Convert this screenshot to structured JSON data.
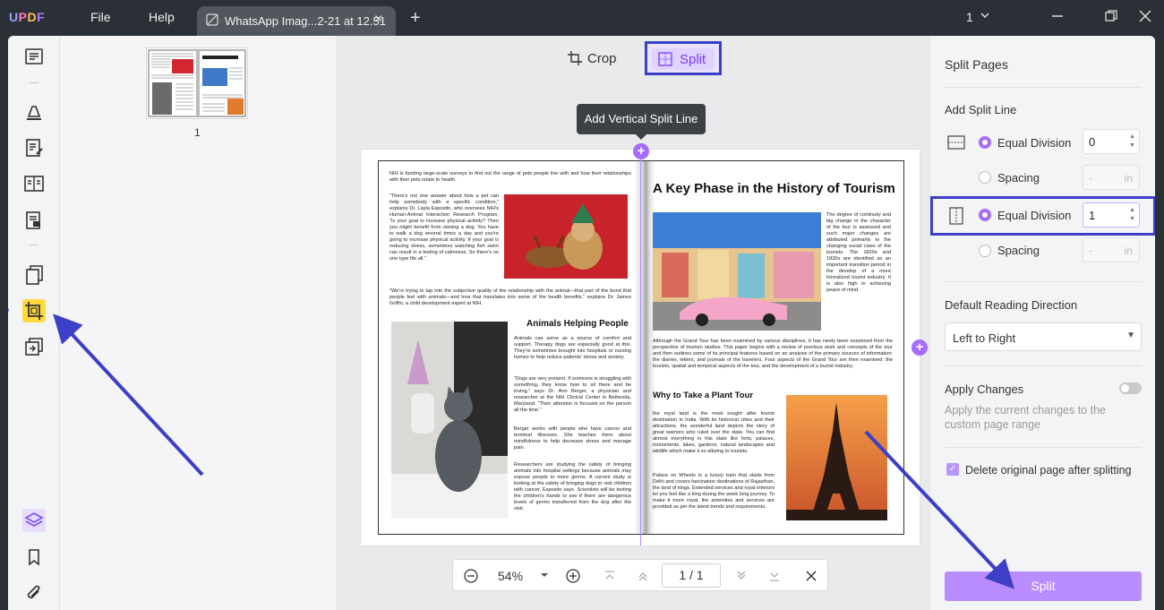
{
  "app": {
    "logo": "UPDF",
    "menu": [
      "File",
      "Help"
    ],
    "tab_title": "WhatsApp Imag...2-21 at 12.51",
    "page_indicator": "1"
  },
  "thumbnails": {
    "page_number": "1"
  },
  "canvas": {
    "toolbar": {
      "crop_label": "Crop",
      "split_label": "Split"
    },
    "tooltip": "Add Vertical Split Line",
    "document": {
      "left": {
        "intro": "NIH is funding large-scale surveys to find out the range of pets people live with and how their relationships with their pets relate to health.",
        "quote": "“There's not one answer about how a pet can help somebody with a specific condition,” explains Dr. Layla Esposito, who oversees NIH's Human-Animal Interaction Research Program. “Is your goal to increase physical activity? Then you might benefit from owning a dog. You have to walk a dog several times a day and you're going to increase physical activity. If your goal is reducing stress, sometimes watching fish swim can result in a feeling of calmness. So there's no one type fits all.”",
        "tap": "“We're trying to tap into the subjective quality of the relationship with the animal—that part of the bond that people feel with animals—and how that translates into some of the health benefits,” explains Dr. James Griffin, a child development expert at NIH.",
        "heading": "Animals Helping People",
        "p1": "Animals can serve as a source of comfort and support. Therapy dogs are especially good at this. They're sometimes brought into hospitals or nursing homes to help reduce patients' stress and anxiety.",
        "p2": "“Dogs are very present. If someone is struggling with something, they know how to sit there and be loving,” says Dr. Ann Berger, a physician and researcher at the NIH Clinical Center in Bethesda, Maryland. “Their attention is focused on the person all the time.”",
        "p3": "Berger works with people who have cancer and terminal illnesses. She teaches them about mindfulness to help decrease stress and manage pain.",
        "p4": "Researchers are studying the safety of bringing animals into hospital settings because animals may expose people to more germs. A current study is looking at the safety of bringing dogs to visit children with cancer, Esposito says. Scientists will be testing the children's hands to see if there are dangerous levels of germs transferred from the dog after the visit."
      },
      "right": {
        "heading": "A Key Phase in the History of Tourism",
        "side": "The degree of continuity and big change in the character of the tour is assessed and such major changes are attributed primarily to the changing social class of the tourists. The 1820s and 1830s are identified as an important transition period in the develop of a more formalized tourist industry. It is also high in achieving peace of mind.",
        "body": "Although the Grand Tour has been examined by various disciplines, it has rarely been examined from the perspective of tourism studies. This paper begins with a review of previous work and concepts of the tour and then outlines some of its principal features based on an analysis of the primary sources of information: the diaries, letters, and journals of the travelers. Four aspects of the Grand Tour are then examined: the tourists, spatial and temporal aspects of the tour, and the development of a tourist industry.",
        "subheading": "Why to Take a Plant Tour",
        "p1": "the royal land is the most sought after tourist destination in India. With its historical cities and their attractions, the wonderful land depicts the story of great warriors who ruled over the state. You can find almost everything in this state like forts, palaces, monuments, lakes, gardens, natural landscapes and wildlife which make it so alluring to tourists.",
        "p2": "Palace on Wheels is a luxury train that starts from Delhi and covers fascination destinations of Rajasthan, the land of kings. Extended services and royal interiors let you feel like a king during the week long journey. To make it more royal, the amenities and services are provided as per the latest trends and requirements."
      }
    },
    "zoombar": {
      "zoom": "54%",
      "page": "1 / 1"
    }
  },
  "panel": {
    "title": "Split Pages",
    "add_split_line": "Add Split Line",
    "horizontal": {
      "equal_division_label": "Equal Division",
      "equal_division_value": "0",
      "spacing_label": "Spacing",
      "spacing_value": "-",
      "spacing_unit": "in"
    },
    "vertical": {
      "equal_division_label": "Equal Division",
      "equal_division_value": "1",
      "spacing_label": "Spacing",
      "spacing_value": "-",
      "spacing_unit": "in"
    },
    "reading_direction_label": "Default Reading Direction",
    "reading_direction_value": "Left to Right",
    "apply_changes_label": "Apply Changes",
    "apply_changes_desc": "Apply the current changes to the custom page range",
    "delete_original_label": "Delete original page after splitting",
    "split_button": "Split"
  },
  "colors": {
    "accent": "#a46cff",
    "annotation": "#3c3fc7",
    "titlebar": "#2b2f36"
  }
}
